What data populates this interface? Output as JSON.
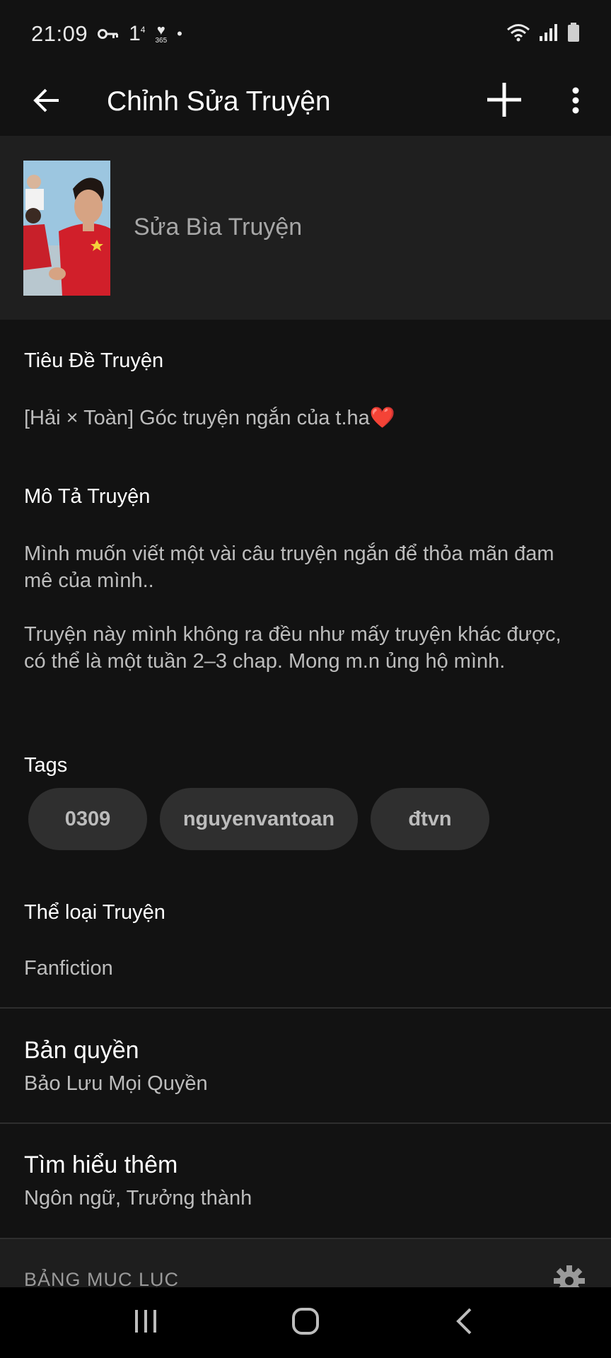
{
  "status_bar": {
    "time": "21:09",
    "key_icon": "key-icon",
    "notif_1": "1",
    "notif_1_sup": "4",
    "notif_365": "365",
    "dot": "•"
  },
  "app_bar": {
    "title": "Chỉnh Sửa Truyện",
    "back_icon": "arrow-left-icon",
    "add_icon": "plus-icon",
    "more_icon": "more-vert-icon"
  },
  "cover": {
    "label": "Sửa Bìa Truyện"
  },
  "story_title": {
    "label": "Tiêu Đề Truyện",
    "value": "[Hải × Toàn] Góc truyện ngắn của t.ha❤️"
  },
  "description": {
    "label": "Mô Tả Truyện",
    "paragraph1": "Mình muốn viết một vài câu truyện ngắn để thỏa mãn đam mê của mình..",
    "paragraph2": "Truyện này mình không ra đều như mấy truyện khác được, có thể là một tuần 2–3 chap. Mong m.n ủng hộ mình."
  },
  "tags": {
    "label": "Tags",
    "items": [
      "0309",
      "nguyenvantoan",
      "đtvn"
    ]
  },
  "genre": {
    "label": "Thể loại Truyện",
    "value": "Fanfiction"
  },
  "copyright": {
    "title": "Bản quyền",
    "value": "Bảo Lưu Mọi Quyền"
  },
  "learn_more": {
    "title": "Tìm hiểu thêm",
    "value": "Ngôn ngữ, Trưởng thành"
  },
  "toc": {
    "label": "BẢNG MỤC LỤC",
    "icon": "gear-icon"
  },
  "nav": {
    "recents_icon": "recents-icon",
    "home_icon": "home-icon",
    "back_icon": "back-chevron-icon"
  }
}
